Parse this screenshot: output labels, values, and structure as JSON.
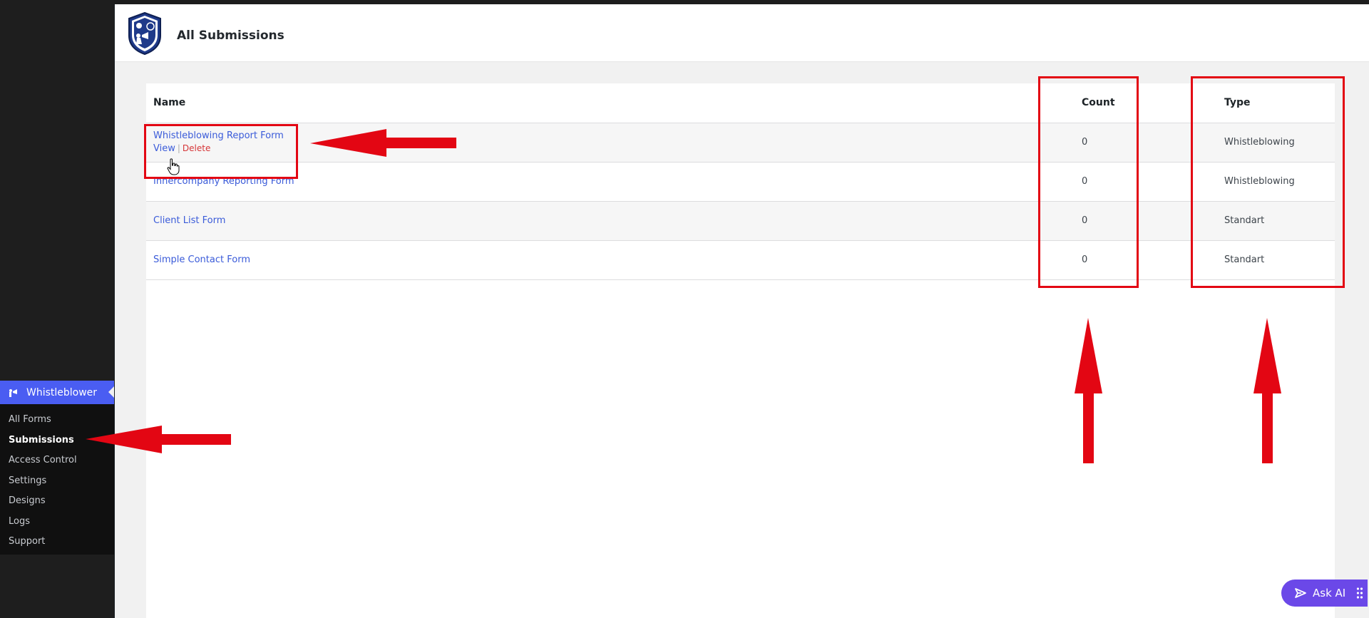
{
  "sidebar": {
    "active_label": "Whistleblower",
    "items": [
      {
        "label": "All Forms"
      },
      {
        "label": "Submissions"
      },
      {
        "label": "Access Control"
      },
      {
        "label": "Settings"
      },
      {
        "label": "Designs"
      },
      {
        "label": "Logs"
      },
      {
        "label": "Support"
      }
    ]
  },
  "header": {
    "title": "All Submissions"
  },
  "table": {
    "columns": [
      "Name",
      "Count",
      "Type"
    ],
    "rows": [
      {
        "name": "Whistleblowing Report Form",
        "count": "0",
        "type": "Whistleblowing"
      },
      {
        "name": "Innercompany Reporting Form",
        "count": "0",
        "type": "Whistleblowing"
      },
      {
        "name": "Client List Form",
        "count": "0",
        "type": "Standart"
      },
      {
        "name": "Simple Contact Form",
        "count": "0",
        "type": "Standart"
      }
    ],
    "row_actions": {
      "view": "View",
      "separator": "|",
      "delete": "Delete"
    }
  },
  "ask_ai": {
    "label": "Ask AI"
  },
  "colors": {
    "accent": "#4a5df2",
    "link": "#3a5bd9",
    "delete": "#d63638",
    "annotation": "#e30613",
    "ask_ai": "#6b48e8"
  },
  "icons": [
    "whistleblower-menu-icon",
    "plugin-shield-logo",
    "ask-ai-icon",
    "drag-grip-icon",
    "hand-cursor-icon"
  ]
}
